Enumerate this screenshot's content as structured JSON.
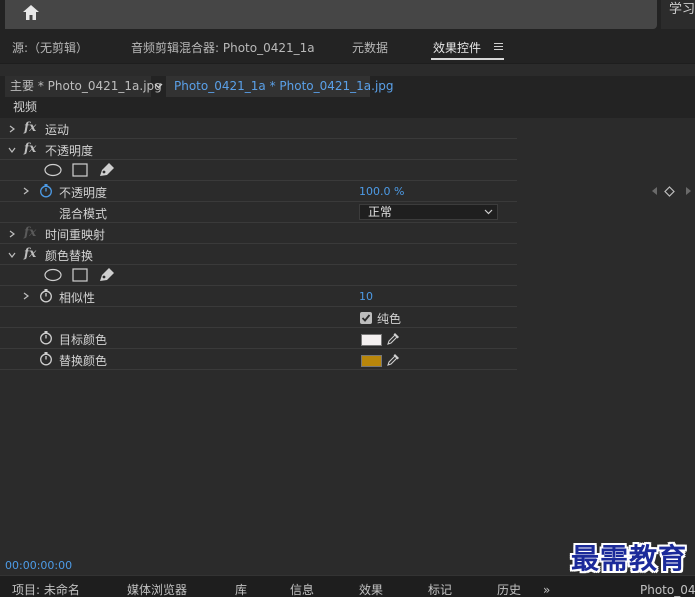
{
  "topbar": {
    "learn_label": "学习"
  },
  "panel_tabs": [
    {
      "label": "源:（无剪辑）"
    },
    {
      "label": "音频剪辑混合器: Photo_0421_1a"
    },
    {
      "label": "元数据"
    },
    {
      "label": "效果控件"
    }
  ],
  "clip_tabs": {
    "master": "主要 * Photo_0421_1a.jpg",
    "sequence": "Photo_0421_1a * Photo_0421_1a.jpg"
  },
  "video_section": "视频",
  "effects": {
    "motion": {
      "fx": "fx",
      "label": "运动"
    },
    "opacity": {
      "fx": "fx",
      "label": "不透明度",
      "property_label": "不透明度",
      "value": "100.0 %",
      "blend_label": "混合模式",
      "blend_value": "正常"
    },
    "time_remap": {
      "fx": "fx",
      "label": "时间重映射"
    },
    "color_replace": {
      "fx": "fx",
      "label": "颜色替换",
      "similarity_label": "相似性",
      "similarity_value": "10",
      "solid_label": "纯色",
      "solid_checked": true,
      "target_label": "目标颜色",
      "target_color": "#f4f0f0",
      "replace_label": "替换颜色",
      "replace_color": "#b8860b"
    }
  },
  "timecode": "00:00:00:00",
  "bottom_tabs": [
    "项目: 未命名",
    "媒体浏览器",
    "库",
    "信息",
    "效果",
    "标记",
    "历史",
    "Photo_04"
  ],
  "watermark": "最需教育",
  "colors": {
    "accent": "#4d9be6",
    "panel": "#2b2b2b"
  }
}
